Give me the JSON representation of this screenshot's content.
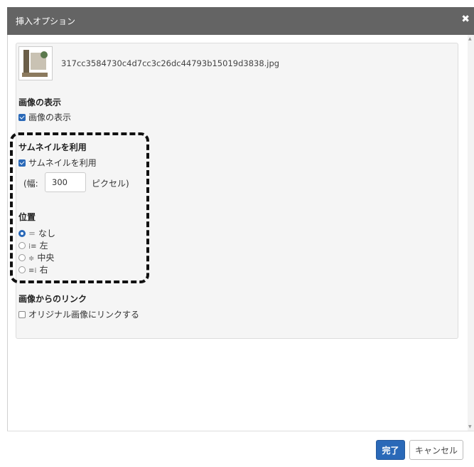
{
  "dialog": {
    "title": "挿入オプション",
    "close_glyph": "✖"
  },
  "file": {
    "filename": "317cc3584730c4d7cc3c26dc44793b15019d3838.jpg"
  },
  "display": {
    "section_title": "画像の表示",
    "checkbox_label": "画像の表示",
    "checked": true
  },
  "thumbnail": {
    "section_title": "サムネイルを利用",
    "checkbox_label": "サムネイルを利用",
    "checked": true,
    "width_prefix": "(幅:",
    "width_value": "300",
    "width_suffix": "ピクセル)"
  },
  "position": {
    "section_title": "位置",
    "options": [
      {
        "icon": "＝",
        "label": "なし",
        "selected": true
      },
      {
        "icon": "⁞≡",
        "label": "左",
        "selected": false
      },
      {
        "icon": "≑",
        "label": "中央",
        "selected": false
      },
      {
        "icon": "≡⁞",
        "label": "右",
        "selected": false
      }
    ]
  },
  "link": {
    "section_title": "画像からのリンク",
    "checkbox_label": "オリジナル画像にリンクする",
    "checked": false
  },
  "footer": {
    "done_label": "完了",
    "cancel_label": "キャンセル"
  },
  "colors": {
    "titlebar": "#646464",
    "accent": "#2a69b8"
  }
}
